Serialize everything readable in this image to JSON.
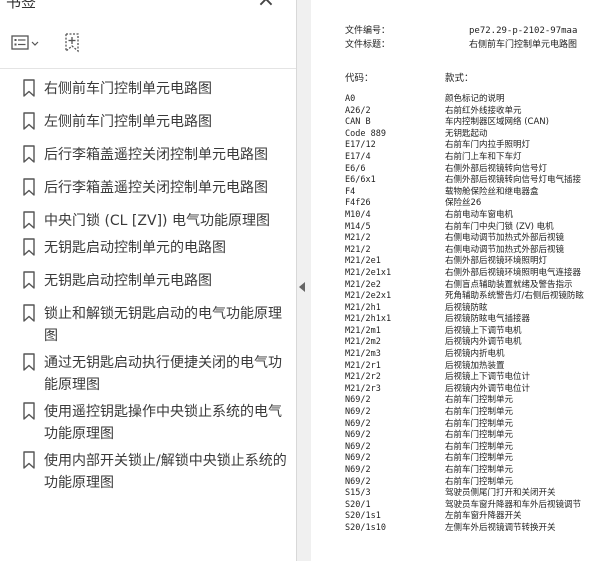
{
  "sidebar": {
    "title": "书签",
    "close_label": "×",
    "options_icon": "list-options-icon",
    "add_bookmark_icon": "add-bookmark-icon",
    "bookmarks": [
      {
        "label": "右侧前车门控制单元电路图"
      },
      {
        "label": "左侧前车门控制单元电路图"
      },
      {
        "label": "后行李箱盖遥控关闭控制单元电路图"
      },
      {
        "label": "后行李箱盖遥控关闭控制单元电路图"
      },
      {
        "label": "中央门锁 (CL [ZV]) 电气功能原理图"
      },
      {
        "label": "无钥匙启动控制单元的电路图"
      },
      {
        "label": "无钥匙启动控制单元电路图"
      },
      {
        "label": "锁止和解锁无钥匙启动的电气功能原理图"
      },
      {
        "label": "通过无钥匙启动执行便捷关闭的电气功能原理图"
      },
      {
        "label": "使用遥控钥匙操作中央锁止系统的电气功能原理图"
      },
      {
        "label": "使用内部开关锁止/解锁中央锁止系统的功能原理图"
      }
    ]
  },
  "document": {
    "meta": [
      {
        "key": "文件编号：",
        "value": "pe72.29-p-2102-97maa"
      },
      {
        "key": "文件标题：",
        "value": "右侧前车门控制单元电路图"
      }
    ],
    "legend_header": {
      "code": "代码：",
      "desc": "款式："
    },
    "rows": [
      {
        "code": "A0",
        "desc": "颜色标记的说明"
      },
      {
        "code": "A26/2",
        "desc": "右前红外线接收单元"
      },
      {
        "code": "CAN B",
        "desc": "车内控制器区域网络 (CAN)"
      },
      {
        "code": "Code 889",
        "desc": "无钥匙起动"
      },
      {
        "code": "E17/12",
        "desc": "右前车门内拉手照明灯"
      },
      {
        "code": "E17/4",
        "desc": "右前门上车和下车灯"
      },
      {
        "code": "E6/6",
        "desc": "右侧外部后视镜转向信号灯"
      },
      {
        "code": "E6/6x1",
        "desc": "右侧外部后视镜转向信号灯电气插接"
      },
      {
        "code": "F4",
        "desc": "载物舱保险丝和继电器盒"
      },
      {
        "code": "F4f26",
        "desc": "保险丝26"
      },
      {
        "code": "M10/4",
        "desc": "右前电动车窗电机"
      },
      {
        "code": "M14/5",
        "desc": "右前车门中央门锁 (ZV) 电机"
      },
      {
        "code": "M21/2",
        "desc": "右侧电动调节加热式外部后视镜"
      },
      {
        "code": "M21/2",
        "desc": "右侧电动调节加热式外部后视镜"
      },
      {
        "code": "M21/2e1",
        "desc": "右侧外部后视镜环境照明灯"
      },
      {
        "code": "M21/2e1x1",
        "desc": "右侧外部后视镜环境照明电气连接器"
      },
      {
        "code": "M21/2e2",
        "desc": "右侧盲点辅助装置就绪及警告指示"
      },
      {
        "code": "M21/2e2x1",
        "desc": "死角辅助系统警告灯/右侧后视镜防眩"
      },
      {
        "code": "M21/2h1",
        "desc": "后视镜防眩"
      },
      {
        "code": "M21/2h1x1",
        "desc": "后视镜防眩电气插接器"
      },
      {
        "code": "M21/2m1",
        "desc": "后视镜上下调节电机"
      },
      {
        "code": "M21/2m2",
        "desc": "后视镜内外调节电机"
      },
      {
        "code": "M21/2m3",
        "desc": "后视镜内折电机"
      },
      {
        "code": "M21/2r1",
        "desc": "后视镜加热装置"
      },
      {
        "code": "M21/2r2",
        "desc": "后视镜上下调节电位计"
      },
      {
        "code": "M21/2r3",
        "desc": "后视镜内外调节电位计"
      },
      {
        "code": "N69/2",
        "desc": "右前车门控制单元"
      },
      {
        "code": "N69/2",
        "desc": "右前车门控制单元"
      },
      {
        "code": "N69/2",
        "desc": "右前车门控制单元"
      },
      {
        "code": "N69/2",
        "desc": "右前车门控制单元"
      },
      {
        "code": "N69/2",
        "desc": "右前车门控制单元"
      },
      {
        "code": "N69/2",
        "desc": "右前车门控制单元"
      },
      {
        "code": "N69/2",
        "desc": "右前车门控制单元"
      },
      {
        "code": "N69/2",
        "desc": "右前车门控制单元"
      },
      {
        "code": "S15/3",
        "desc": "驾驶员侧尾门打开和关闭开关"
      },
      {
        "code": "S20/1",
        "desc": "驾驶员车窗升降器和车外后视镜调节"
      },
      {
        "code": "S20/1s1",
        "desc": "左前车窗升降器开关"
      },
      {
        "code": "S20/1s10",
        "desc": "左侧车外后视镜调节转换开关"
      }
    ]
  }
}
